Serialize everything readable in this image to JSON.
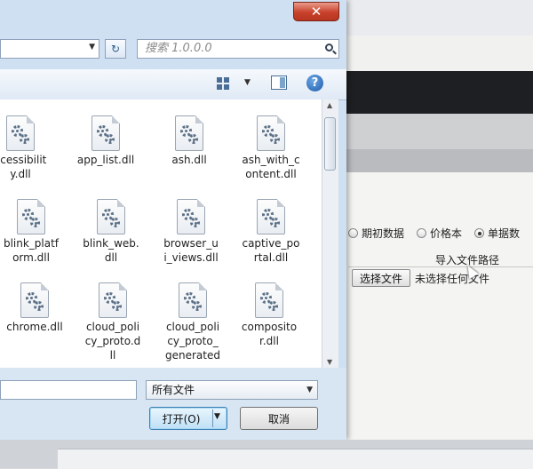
{
  "dialog": {
    "close_glyph": "✕",
    "address": {
      "value": "",
      "dropdown_glyph": "▼"
    },
    "refresh_glyph": "↻",
    "search": {
      "placeholder": "搜索 1.0.0.0"
    },
    "toolbar": {
      "views_dropdown_glyph": "▼",
      "help_glyph": "?"
    },
    "files": [
      {
        "name": "ccessibilit\ny.dll",
        "icon": "dll-file-icon"
      },
      {
        "name": "app_list.dll",
        "icon": "dll-file-icon"
      },
      {
        "name": "ash.dll",
        "icon": "dll-file-icon"
      },
      {
        "name": "ash_with_c\nontent.dll",
        "icon": "dll-file-icon"
      },
      {
        "name": "blink_platf\norm.dll",
        "icon": "dll-file-icon"
      },
      {
        "name": "blink_web.\ndll",
        "icon": "dll-file-icon"
      },
      {
        "name": "browser_u\ni_views.dll",
        "icon": "dll-file-icon"
      },
      {
        "name": "captive_po\nrtal.dll",
        "icon": "dll-file-icon"
      },
      {
        "name": "chrome.dll",
        "icon": "dll-file-icon"
      },
      {
        "name": "cloud_poli\ncy_proto.d\nll",
        "icon": "dll-file-icon"
      },
      {
        "name": "cloud_poli\ncy_proto_\ngenerated",
        "icon": "dll-file-icon"
      },
      {
        "name": "composito\nr.dll",
        "icon": "dll-file-icon"
      }
    ],
    "scrollbar": {
      "up_glyph": "▲",
      "down_glyph": "▼"
    },
    "file_name_field": {
      "value": ""
    },
    "file_type": {
      "selected": "所有文件",
      "dropdown_glyph": "▼"
    },
    "open_button": {
      "label": "打开(O)",
      "arrow": "▼"
    },
    "cancel_button": {
      "label": "取消"
    }
  },
  "background_app": {
    "radio_options": [
      {
        "label": "期初数据",
        "selected": false
      },
      {
        "label": "价格本",
        "selected": false
      },
      {
        "label": "单据数",
        "selected": true
      }
    ],
    "import_label": "导入文件路径",
    "choose_file_button": "选择文件",
    "no_file_text": "未选择任何文件"
  }
}
